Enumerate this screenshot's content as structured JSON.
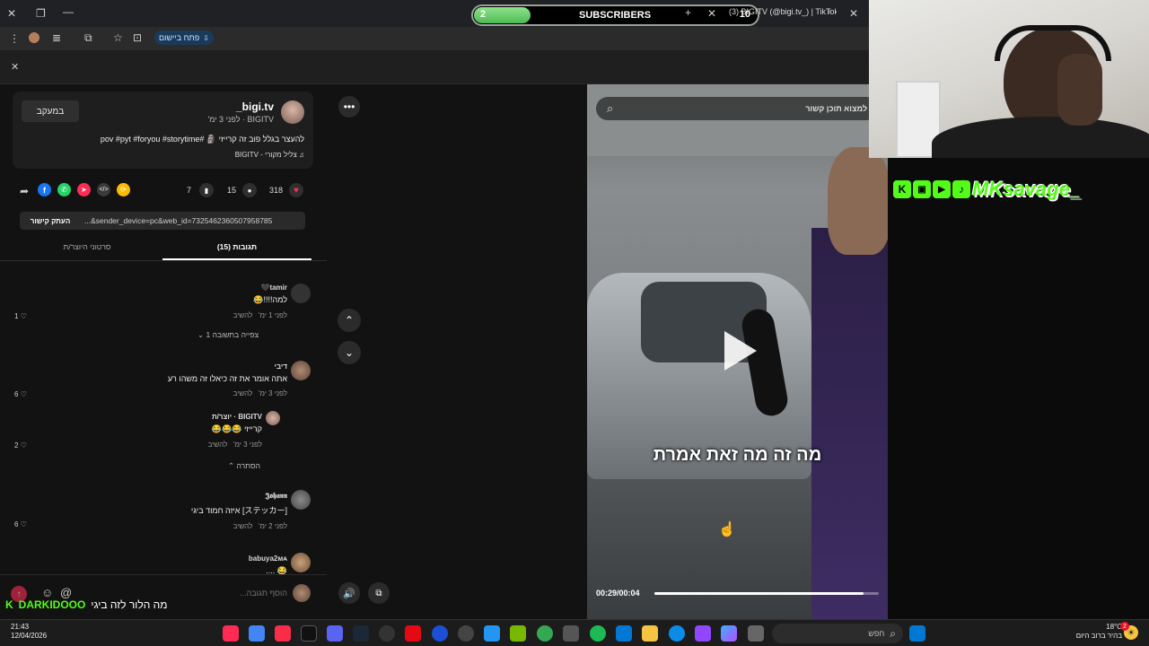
{
  "browser": {
    "tab_title": "BIGITV (@bigi.tv_) | TikTok",
    "tab_sound_count": "(3)",
    "install_app_label": "פתח ביישום"
  },
  "overlay": {
    "subscribers_count": "2",
    "subscribers_label": "SUBSCRIBERS",
    "subscribers_goal": "10",
    "subscribers_progress": 0.2,
    "streamer_handle": "MKsavage_",
    "chat_user": "DARKIDOOO",
    "chat_message": "מה הלור לזה ביגי"
  },
  "post": {
    "username": "bigi.tv_",
    "subtitle": "BIGITV · לפני 3 ימ'",
    "follow_label": "במעקב",
    "caption": "להעצר בגלל פוב זה קרייזי 🗿 #pov #pyt #foryou #storytime",
    "sound": "צליל מקורי - BIGITV",
    "likes": "318",
    "comments": "15",
    "saves": "7",
    "link_text": "...&sender_device=pc&web_id=7325462360507958785",
    "copy_link_label": "העתק קישור",
    "tab_comments": "תגובות (15)",
    "tab_creator": "סרטוני היוצר/ת"
  },
  "comments": [
    {
      "name": "tamir🖤",
      "text": "למה!!!!😂",
      "time": "לפני 1 ימ'",
      "reply": "להשיב",
      "likes": "1",
      "view_replies": "צפייה בתשובה 1"
    },
    {
      "name": "דיבי",
      "text": "אתה אומר את זה כיאלו זה משהו רע",
      "time": "לפני 3 ימ'",
      "reply": "להשיב",
      "likes": "6"
    },
    {
      "name": "BIGITV · יוצר/ת",
      "text": "קרייזי 😂😂😂",
      "time": "לפני 3 ימ'",
      "reply": "להשיב",
      "likes": "2",
      "hide": "הסתרה"
    },
    {
      "name": "𝕵𝖔𝖍𝖆𝖓𝖓",
      "text": "[ステッカー] איזה חמוד ביגי",
      "time": "לפני 2 ימ'",
      "reply": "להשיב",
      "likes": "6"
    },
    {
      "name": "babuya2ᴍᴀ",
      "text": "😂 ....",
      "time": "",
      "reply": "",
      "likes": ""
    }
  ],
  "comment_input": {
    "placeholder": "הוסף תגובה..."
  },
  "video": {
    "search_placeholder": "למצוא תוכן קשור",
    "caption": "מה זה מה זאת אמרת",
    "time": "00:29/00:04",
    "progress": 0.93
  },
  "taskbar": {
    "search_placeholder": "חפש",
    "clock_time": "21:43",
    "clock_date": "12/04/2026",
    "weather_temp": "18°C",
    "weather_desc": "בהיר ברוב היום",
    "notification_count": "2"
  },
  "colors": {
    "accent_pink": "#fe2c55",
    "overlay_green": "#5fd66a",
    "kick_green": "#53fc18"
  }
}
